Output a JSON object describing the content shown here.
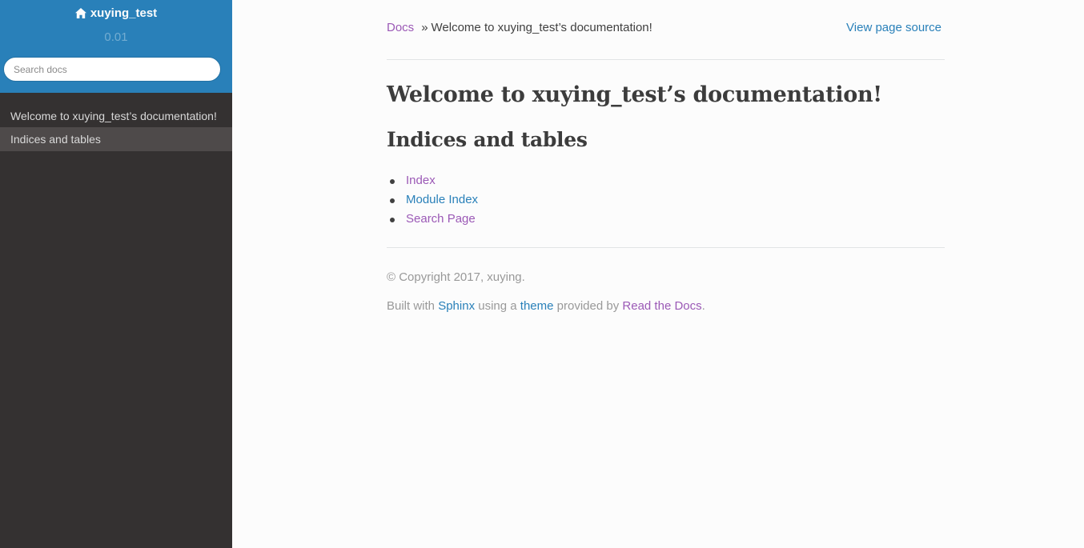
{
  "sidebar": {
    "project_name": "xuying_test",
    "version": "0.01",
    "search_placeholder": "Search docs",
    "items": [
      {
        "label": "Welcome to xuying_test’s documentation!"
      },
      {
        "label": "Indices and tables"
      }
    ]
  },
  "breadcrumbs": {
    "root": "Docs",
    "separator": "»",
    "current": "Welcome to xuying_test’s documentation!",
    "view_source": "View page source"
  },
  "content": {
    "title": "Welcome to xuying_test’s documentation!",
    "section_title": "Indices and tables",
    "links": [
      {
        "label": "Index"
      },
      {
        "label": "Module Index"
      },
      {
        "label": "Search Page"
      }
    ]
  },
  "footer": {
    "copyright": "© Copyright 2017, xuying.",
    "built_with": "Built with",
    "sphinx": "Sphinx",
    "using_a": "using a",
    "theme": "theme",
    "provided_by": "provided by",
    "rtd": "Read the Docs",
    "period": "."
  },
  "colors": {
    "sidebar_top": "#2980b9",
    "sidebar_bg": "#343131",
    "link": "#2980b9",
    "visited_link": "#9b59b6",
    "text": "#404040"
  }
}
